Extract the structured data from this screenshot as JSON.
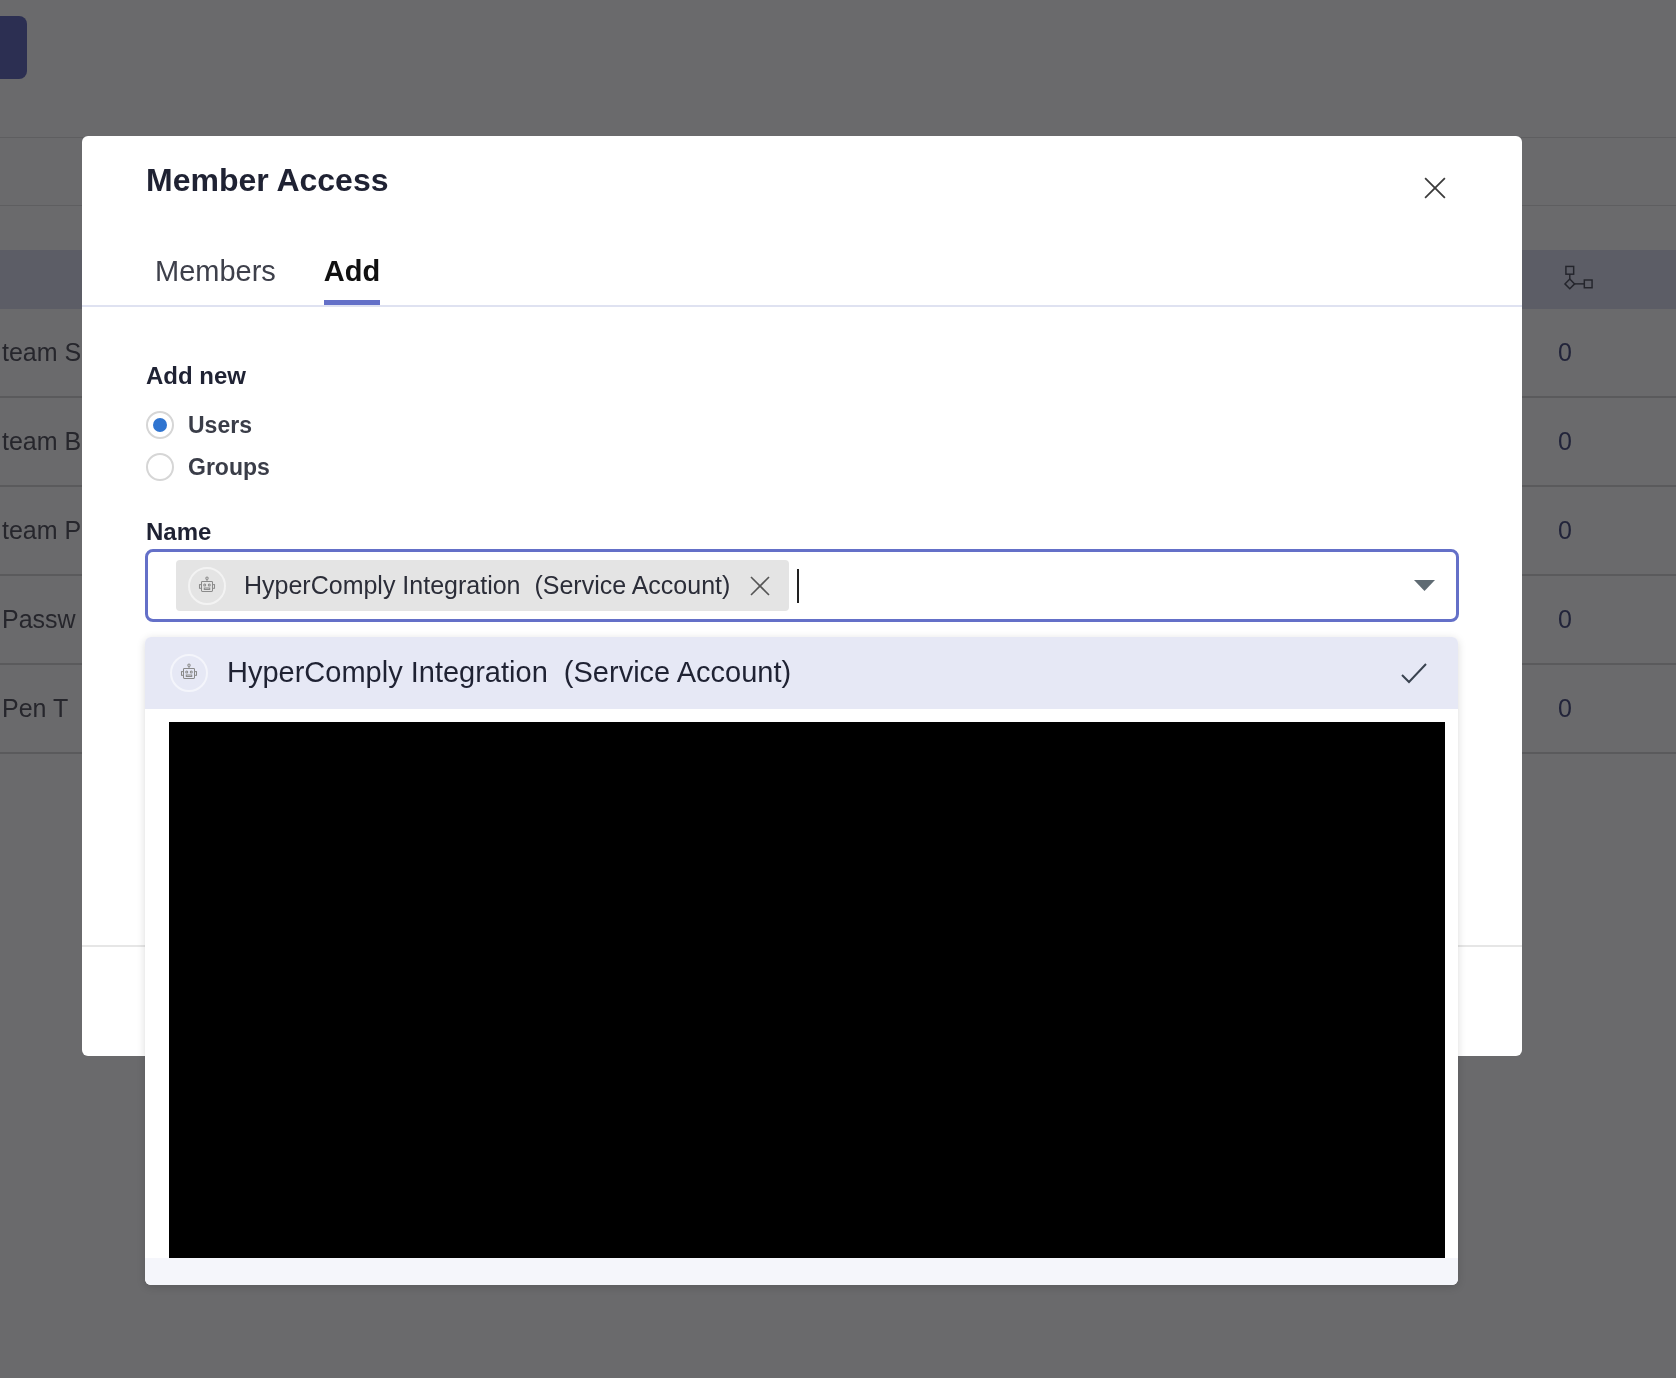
{
  "background": {
    "table": {
      "rows": [
        {
          "column_1": "team S",
          "column_2": "0"
        },
        {
          "column_1": "team B",
          "column_2": "0"
        },
        {
          "column_1": "team P",
          "column_2": "0"
        },
        {
          "column_1": "Passw",
          "column_2": "0"
        },
        {
          "column_1": "Pen T",
          "column_2": "0"
        }
      ]
    }
  },
  "dialog": {
    "title": "Member Access",
    "tabs": [
      {
        "label": "Members",
        "selected": false
      },
      {
        "label": "Add",
        "selected": true
      }
    ],
    "add_new": {
      "label": "Add new",
      "options": [
        {
          "label": "Users",
          "selected": true
        },
        {
          "label": "Groups",
          "selected": false
        }
      ]
    },
    "name_field": {
      "label": "Name",
      "chips": [
        {
          "label": "HyperComply Integration  (Service Account)"
        }
      ],
      "expanded": true,
      "options": [
        {
          "label": "HyperComply Integration  (Service Account)",
          "selected": true
        }
      ]
    }
  }
}
